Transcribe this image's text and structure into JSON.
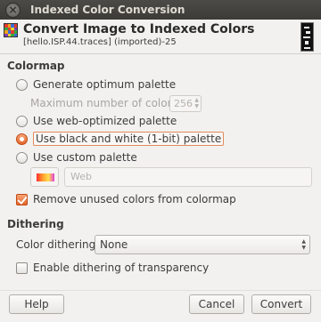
{
  "window": {
    "title": "Indexed Color Conversion"
  },
  "header": {
    "title": "Convert Image to Indexed Colors",
    "subtitle": "[hello.ISP.44.traces] (imported)-25"
  },
  "colormap": {
    "section_title": "Colormap",
    "generate_optimum_label": "Generate optimum palette",
    "max_colors_label": "Maximum number of colors:",
    "max_colors_value": "256",
    "web_optimized_label": "Use web-optimized palette",
    "bw_label": "Use black and white (1-bit) palette",
    "custom_label": "Use custom palette",
    "custom_palette_value": "Web",
    "remove_unused_label": "Remove unused colors from colormap",
    "selected": "bw",
    "remove_unused_checked": true
  },
  "dithering": {
    "section_title": "Dithering",
    "color_dithering_label": "Color dithering:",
    "color_dithering_value": "None",
    "transparency_label": "Enable dithering of transparency",
    "transparency_checked": false
  },
  "buttons": {
    "help": "Help",
    "cancel": "Cancel",
    "convert": "Convert"
  }
}
